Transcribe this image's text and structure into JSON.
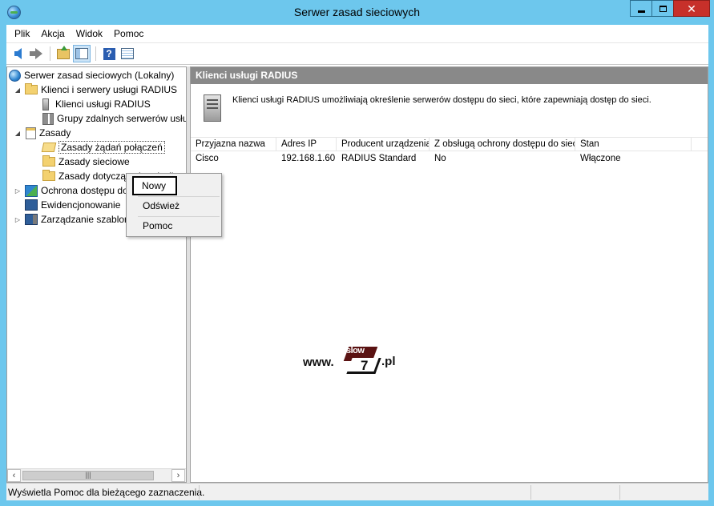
{
  "window": {
    "title": "Serwer zasad sieciowych"
  },
  "menu": [
    "Plik",
    "Akcja",
    "Widok",
    "Pomoc"
  ],
  "tree": {
    "root": "Serwer zasad sieciowych (Lokalny)",
    "radius_group": "Klienci i serwery usługi RADIUS",
    "radius_clients": "Klienci usługi RADIUS",
    "remote_groups": "Grupy zdalnych serwerów usługi RADIUS",
    "policies": "Zasady",
    "connection_request": "Zasady żądań połączeń",
    "network_policies": "Zasady sieciowe",
    "health_policies": "Zasady dotyczące kondycji",
    "nap": "Ochrona dostępu do sieci",
    "accounting": "Ewidencjonowanie",
    "templates": "Zarządzanie szablonami"
  },
  "right_pane": {
    "header": "Klienci usługi RADIUS",
    "description": "Klienci usługi RADIUS umożliwiają określenie serwerów dostępu do sieci, które zapewniają dostęp do sieci.",
    "columns": [
      "Przyjazna nazwa",
      "Adres IP",
      "Producent urządzenia",
      "Z obsługą ochrony dostępu do sieci",
      "Stan"
    ],
    "rows": [
      [
        "Cisco",
        "192.168.1.60",
        "RADIUS Standard",
        "No",
        "Włączone"
      ]
    ]
  },
  "context_menu": [
    "Nowy",
    "Odśwież",
    "Pomoc"
  ],
  "watermark": {
    "www": "www.",
    "flag": "slow",
    "seven": "7",
    "tld": ".pl"
  },
  "status": "Wyświetla Pomoc dla bieżącego zaznaczenia.",
  "icons": {
    "back": "back-arrow-icon",
    "forward": "forward-arrow-icon",
    "up": "folder-up-icon",
    "show_hide": "console-tree-icon",
    "help": "help-icon",
    "properties": "properties-icon"
  }
}
